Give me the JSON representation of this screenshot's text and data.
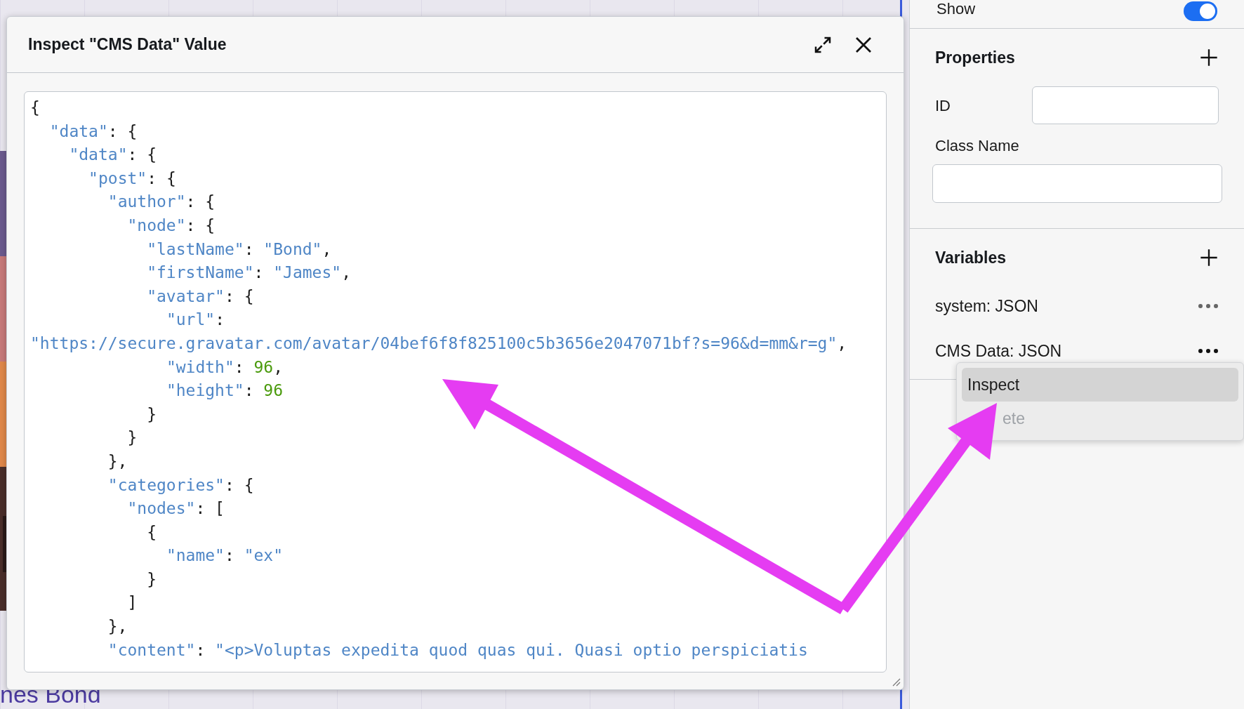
{
  "canvas": {
    "caption": "nes Bond"
  },
  "dialog": {
    "title": "Inspect \"CMS Data\" Value",
    "lines": [
      "{",
      "  \"data\": {",
      "    \"data\": {",
      "      \"post\": {",
      "        \"author\": {",
      "          \"node\": {",
      "            \"lastName\": \"Bond\",",
      "            \"firstName\": \"James\",",
      "            \"avatar\": {",
      "              \"url\":",
      "\"https://secure.gravatar.com/avatar/04bef6f8f825100c5b3656e2047071bf?s=96&d=mm&r=g\",",
      "              \"width\": 96,",
      "              \"height\": 96",
      "            }",
      "          }",
      "        },",
      "        \"categories\": {",
      "          \"nodes\": [",
      "            {",
      "              \"name\": \"ex\"",
      "            }",
      "          ]",
      "        },",
      "        \"content\": \"<p>Voluptas expedita quod quas qui. Quasi optio perspiciatis"
    ]
  },
  "panel": {
    "show": {
      "label": "Show",
      "on": true
    },
    "properties": {
      "title": "Properties",
      "fields": [
        {
          "label": "ID",
          "kind": "inline"
        },
        {
          "label": "Class Name",
          "kind": "stacked"
        }
      ]
    },
    "variables": {
      "title": "Variables",
      "items": [
        {
          "name": "system: JSON",
          "menu_open": false
        },
        {
          "name": "CMS Data: JSON",
          "menu_open": true
        }
      ]
    },
    "menu": [
      {
        "label": "Inspect",
        "selected": true,
        "disabled": false
      },
      {
        "label": "ete",
        "selected": false,
        "disabled": true
      }
    ]
  }
}
